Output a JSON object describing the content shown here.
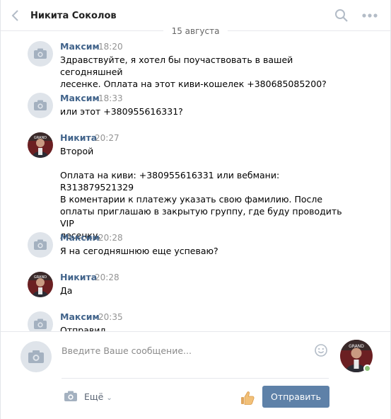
{
  "header": {
    "title": "Никита Соколов"
  },
  "date_separator": "15 августа",
  "messages": [
    {
      "author": "Максим",
      "time": "18:20",
      "avatar": "camera-placeholder",
      "lines": [
        "Здравствуйте, я хотел бы поучаствовать в вашей сегодняшней",
        "лесенке. Оплата на этот киви-кошелек +380685085200?"
      ]
    },
    {
      "author": "Максим",
      "time": "18:33",
      "avatar": "camera-placeholder",
      "lines": [
        "или этот +380955616331?"
      ]
    },
    {
      "author": "Никита",
      "time": "20:27",
      "avatar": "user-photo",
      "lines": [
        "Второй",
        "",
        "Оплата на киви: +380955616331 или вебмани: R313879521329",
        "В коментарии к платежу указать свою фамилию. После",
        "оплаты приглашаю в закрытую группу, где буду проводить VIP",
        "лесенку."
      ]
    },
    {
      "author": "Максим",
      "time": "20:28",
      "avatar": "camera-placeholder",
      "lines": [
        "Я на сегодняшнюю еще успеваю?"
      ]
    },
    {
      "author": "Никита",
      "time": "20:28",
      "avatar": "user-photo",
      "lines": [
        "Да"
      ]
    },
    {
      "author": "Максим",
      "time": "20:35",
      "avatar": "camera-placeholder",
      "lines": [
        "Отправил"
      ]
    }
  ],
  "composer": {
    "placeholder": "Введите Ваше сообщение...",
    "more_label": "Ещё",
    "send_label": "Отправить"
  },
  "colors": {
    "author": "#42648b",
    "send_button": "#5e81a8",
    "online": "#8ac176"
  }
}
